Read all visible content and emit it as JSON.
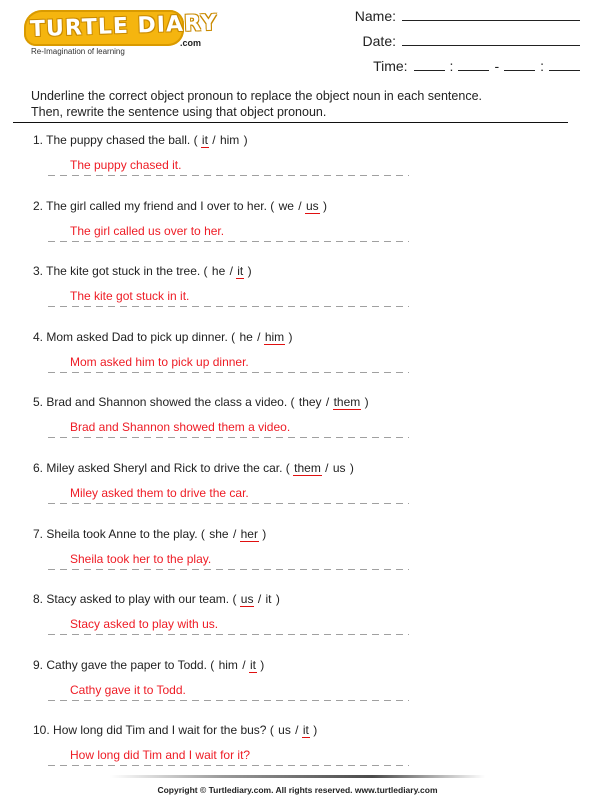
{
  "logo": {
    "name": "TURTLE DIARY",
    "suffix": ".com",
    "tagline": "Re-Imagination of learning"
  },
  "header": {
    "name_label": "Name:",
    "date_label": "Date:",
    "time_label": "Time:",
    "time_colon": ":",
    "time_dash": "-"
  },
  "instructions": {
    "line1": "Underline the correct object pronoun to replace the object noun in each sentence.",
    "line2": "Then, rewrite the sentence using that object pronoun."
  },
  "questions": [
    {
      "number": "1.",
      "sentence": "The puppy chased the ball.",
      "options": [
        "it",
        "him"
      ],
      "correct": 0,
      "answer": "The puppy chased it."
    },
    {
      "number": "2.",
      "sentence": "The girl called my friend and I over to her.",
      "options": [
        "we",
        "us"
      ],
      "correct": 1,
      "answer": "The girl called us over to her."
    },
    {
      "number": "3.",
      "sentence": "The kite got stuck in the tree.",
      "options": [
        "he",
        "it"
      ],
      "correct": 1,
      "answer": "The kite got stuck in it."
    },
    {
      "number": "4.",
      "sentence": "Mom asked Dad to pick up dinner.",
      "options": [
        "he",
        "him"
      ],
      "correct": 1,
      "answer": "Mom asked him to pick up dinner."
    },
    {
      "number": "5.",
      "sentence": "Brad and Shannon showed the class a video.",
      "options": [
        "they",
        "them"
      ],
      "correct": 1,
      "answer": "Brad and Shannon showed them a video."
    },
    {
      "number": "6.",
      "sentence": "Miley asked Sheryl and Rick to drive the car.",
      "options": [
        "them",
        "us"
      ],
      "correct": 0,
      "answer": "Miley asked them to drive the car."
    },
    {
      "number": "7.",
      "sentence": "Sheila took Anne to the play.",
      "options": [
        "she",
        "her"
      ],
      "correct": 1,
      "answer": "Sheila took her to the play."
    },
    {
      "number": "8.",
      "sentence": "Stacy asked to play with our team.",
      "options": [
        "us",
        "it"
      ],
      "correct": 0,
      "answer": "Stacy asked to play with us."
    },
    {
      "number": "9.",
      "sentence": "Cathy gave the paper to Todd.",
      "options": [
        "him",
        "it"
      ],
      "correct": 1,
      "answer": "Cathy gave it to Todd."
    },
    {
      "number": "10.",
      "sentence": "How long did Tim and I wait for the bus?",
      "options": [
        "us",
        "it"
      ],
      "correct": 1,
      "answer": "How long did Tim and I wait for it?"
    }
  ],
  "footer": {
    "copyright": "Copyright © Turtlediary.com. All rights reserved. www.turtlediary.com"
  },
  "colors": {
    "answer_red": "#ee1c25",
    "underline_red": "#e01010",
    "logo_yellow": "#f5b50f"
  }
}
